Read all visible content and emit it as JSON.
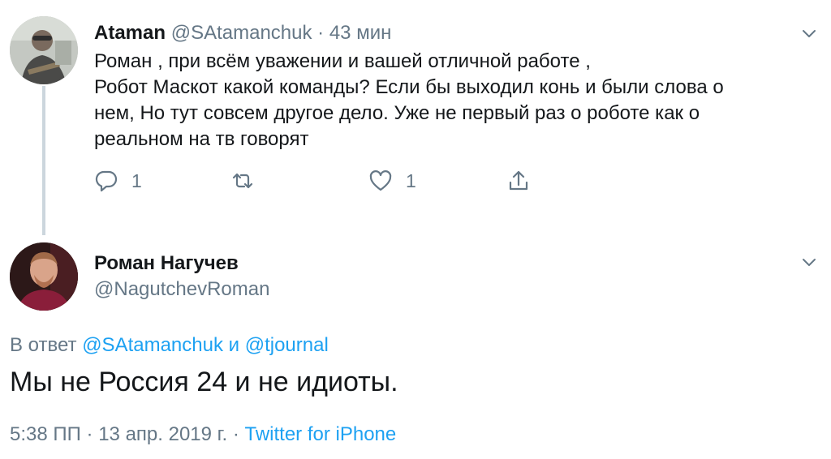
{
  "reply_tweet": {
    "name": "Ataman",
    "handle": "@SAtamanchuk",
    "separator": "·",
    "time": "43 мин",
    "body_lines": [
      "Роман , при всём уважении и вашей отличной работе ,",
      "Робот Маскот какой команды? Если бы выходил конь и были слова о",
      "нем, Но тут совсем другое дело. Уже не первый раз о роботе как о",
      "реальном на тв говорят"
    ],
    "reply_count": "1",
    "retweet_count": "",
    "like_count": "1",
    "avatar_icon": "user-avatar-photo",
    "menu_icon": "chevron-down-icon"
  },
  "main_tweet": {
    "name": "Роман Нагучев",
    "handle": "@NagutchevRoman",
    "reply_to_prefix": "В ответ",
    "reply_to_user1": "@SAtamanchuk",
    "reply_to_and": "и",
    "reply_to_user2": "@tjournal",
    "text": "Мы не Россия 24 и не идиоты.",
    "timestamp": "5:38 ПП · 13 апр. 2019 г. ·",
    "source": "Twitter for iPhone",
    "avatar_icon": "user-avatar-photo",
    "menu_icon": "chevron-down-icon"
  },
  "colors": {
    "text_primary": "#14171a",
    "text_secondary": "#657786",
    "link": "#1da1f2",
    "thread_line": "#ccd6dd"
  }
}
